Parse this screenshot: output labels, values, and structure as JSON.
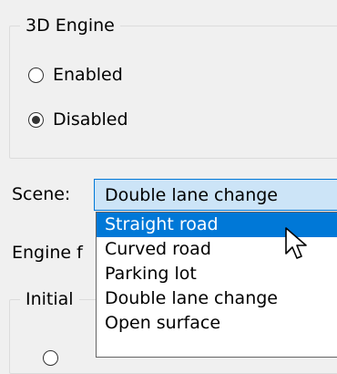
{
  "engine_group": {
    "title": "3D Engine",
    "options": [
      {
        "label": "Enabled",
        "selected": false
      },
      {
        "label": "Disabled",
        "selected": true
      }
    ]
  },
  "scene": {
    "label": "Scene:",
    "value": "Double lane change",
    "options": [
      "Straight road",
      "Curved road",
      "Parking lot",
      "Double lane change",
      "Open surface"
    ],
    "highlighted_option": "Straight road"
  },
  "engine_field_label": "Engine f",
  "initial_group": {
    "title": "Initial"
  },
  "colors": {
    "highlight": "#0078d7",
    "combo_bg": "#cce4f7",
    "window_bg": "#f0f0f0"
  },
  "icons": {
    "cursor": "arrow-cursor-icon"
  }
}
